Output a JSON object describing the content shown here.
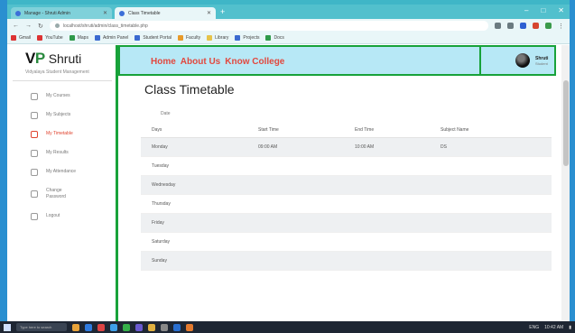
{
  "browser": {
    "tabs": [
      {
        "label": "Manage - Shruti Admin",
        "active": false
      },
      {
        "label": "Class Timetable",
        "active": true
      }
    ],
    "new_tab": "+",
    "window_controls": [
      "–",
      "□",
      "✕"
    ],
    "url": "localhost/shruti/admin/class_timetable.php",
    "bookmarks": [
      "Gmail",
      "YouTube",
      "Maps",
      "Admin Panel",
      "Student Portal",
      "Faculty",
      "Library",
      "Projects",
      "Docs"
    ]
  },
  "sidebar": {
    "brand_vp": "V",
    "brand_p": "P",
    "brand_name": "Shruti",
    "brand_sub": "Vidyalaya Student Management",
    "items": [
      {
        "label": "My Courses",
        "active": false
      },
      {
        "label": "My Subjects",
        "active": false
      },
      {
        "label": "My Timetable",
        "active": true
      },
      {
        "label": "My Results",
        "active": false
      },
      {
        "label": "My Attendance",
        "active": false
      },
      {
        "label": "Change Password",
        "active": false
      },
      {
        "label": "Logout",
        "active": false
      }
    ]
  },
  "header": {
    "nav": [
      "Home",
      "About Us",
      "Know College"
    ],
    "user_name": "Shruti",
    "user_role": "Student"
  },
  "main": {
    "title": "Class Timetable",
    "sub": "Date",
    "columns": [
      "Days",
      "Start Time",
      "End Time",
      "Subject Name"
    ],
    "rows": [
      [
        "Monday",
        "09:00 AM",
        "10:00 AM",
        "DS"
      ],
      [
        "Tuesday",
        "",
        "",
        ""
      ],
      [
        "Wednesday",
        "",
        "",
        ""
      ],
      [
        "Thursday",
        "",
        "",
        ""
      ],
      [
        "Friday",
        "",
        "",
        ""
      ],
      [
        "Saturday",
        "",
        "",
        ""
      ],
      [
        "Sunday",
        "",
        "",
        ""
      ]
    ]
  },
  "taskbar": {
    "search": "Type here to search",
    "time": "10:42 AM",
    "lang": "ENG"
  }
}
